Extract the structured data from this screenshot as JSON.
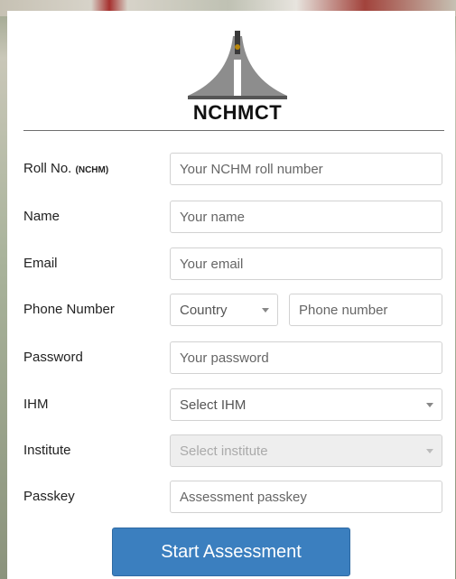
{
  "logo": {
    "text": "NCHMCT"
  },
  "form": {
    "roll": {
      "label": "Roll No.",
      "label_suffix": "(NCHM)",
      "placeholder": "Your NCHM roll number"
    },
    "name": {
      "label": "Name",
      "placeholder": "Your name"
    },
    "email": {
      "label": "Email",
      "placeholder": "Your email"
    },
    "phone": {
      "label": "Phone Number",
      "country_placeholder": "Country",
      "placeholder": "Phone number"
    },
    "password": {
      "label": "Password",
      "placeholder": "Your password"
    },
    "ihm": {
      "label": "IHM",
      "placeholder": "Select IHM"
    },
    "institute": {
      "label": "Institute",
      "placeholder": "Select institute"
    },
    "passkey": {
      "label": "Passkey",
      "placeholder": "Assessment passkey"
    }
  },
  "submit": {
    "label": "Start Assessment"
  },
  "colors": {
    "button": "#3b7fbf",
    "divider": "#6e6e6e"
  }
}
